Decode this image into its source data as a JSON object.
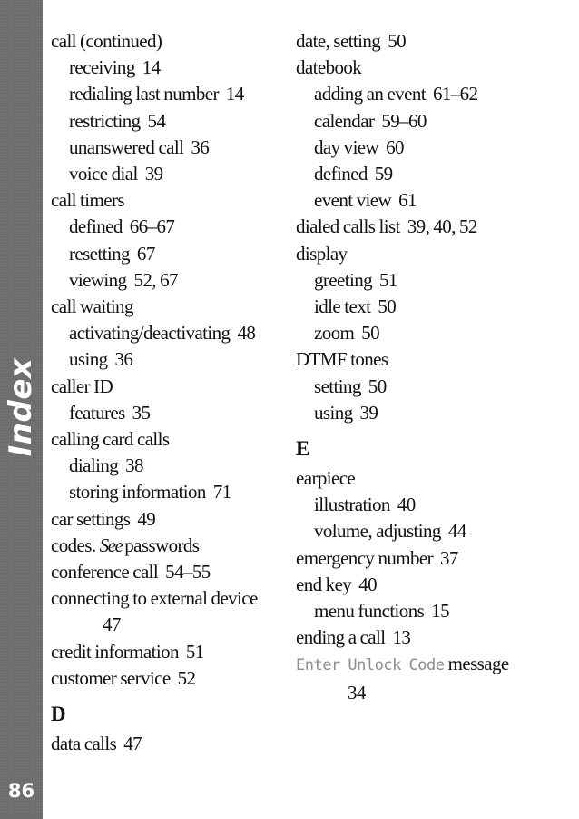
{
  "sidebar": {
    "section_label": "Index",
    "page_number": "86",
    "background_color": "#6e6e6e",
    "text_color": "#ffffff"
  },
  "left_column": {
    "e0": {
      "term": "call (continued)",
      "pages": ""
    },
    "e1": {
      "term": "receiving",
      "pages": "14"
    },
    "e2": {
      "term": "redialing last number",
      "pages": "14"
    },
    "e3": {
      "term": "restricting",
      "pages": "54"
    },
    "e4": {
      "term": "unanswered call",
      "pages": "36"
    },
    "e5": {
      "term": "voice dial",
      "pages": "39"
    },
    "e6": {
      "term": "call timers",
      "pages": ""
    },
    "e7": {
      "term": "defined",
      "pages": "66–67"
    },
    "e8": {
      "term": "resetting",
      "pages": "67"
    },
    "e9": {
      "term": "viewing",
      "pages": "52, 67"
    },
    "e10": {
      "term": "call waiting",
      "pages": ""
    },
    "e11": {
      "term": "activating/deactivating",
      "pages": "48"
    },
    "e12": {
      "term": "using",
      "pages": "36"
    },
    "e13": {
      "term": "caller ID",
      "pages": ""
    },
    "e14": {
      "term": "features",
      "pages": "35"
    },
    "e15": {
      "term": "calling card calls",
      "pages": ""
    },
    "e16": {
      "term": "dialing",
      "pages": "38"
    },
    "e17": {
      "term": "storing information",
      "pages": "71"
    },
    "e18": {
      "term": "car settings",
      "pages": "49"
    },
    "e19": {
      "term": "codes.",
      "see": "See",
      "see_target": "passwords"
    },
    "e20": {
      "term": "conference call",
      "pages": "54–55"
    },
    "e21": {
      "term": "connecting to external device",
      "pages": "47"
    },
    "e22": {
      "term": "credit information",
      "pages": "51"
    },
    "e23": {
      "term": "customer service",
      "pages": "52"
    },
    "letter_d": "D",
    "e24": {
      "term": "data calls",
      "pages": "47"
    }
  },
  "right_column": {
    "e0": {
      "term": "date, setting",
      "pages": "50"
    },
    "e1": {
      "term": "datebook",
      "pages": ""
    },
    "e2": {
      "term": "adding an event",
      "pages": "61–62"
    },
    "e3": {
      "term": "calendar",
      "pages": "59–60"
    },
    "e4": {
      "term": "day view",
      "pages": "60"
    },
    "e5": {
      "term": "defined",
      "pages": "59"
    },
    "e6": {
      "term": "event view",
      "pages": "61"
    },
    "e7": {
      "term": "dialed calls list",
      "pages": "39, 40, 52"
    },
    "e8": {
      "term": "display",
      "pages": ""
    },
    "e9": {
      "term": "greeting",
      "pages": "51"
    },
    "e10": {
      "term": "idle text",
      "pages": "50"
    },
    "e11": {
      "term": "zoom",
      "pages": "50"
    },
    "e12": {
      "term": "DTMF tones",
      "pages": ""
    },
    "e13": {
      "term": "setting",
      "pages": "50"
    },
    "e14": {
      "term": "using",
      "pages": "39"
    },
    "letter_e": "E",
    "e15": {
      "term": "earpiece",
      "pages": ""
    },
    "e16": {
      "term": "illustration",
      "pages": "40"
    },
    "e17": {
      "term": "volume, adjusting",
      "pages": "44"
    },
    "e18": {
      "term": "emergency number",
      "pages": "37"
    },
    "e19": {
      "term": "end key",
      "pages": "40"
    },
    "e20": {
      "term": "menu functions",
      "pages": "15"
    },
    "e21": {
      "term": "ending a call",
      "pages": "13"
    },
    "e22": {
      "display_text": "Enter Unlock Code",
      "term": "message",
      "pages": "34"
    }
  }
}
